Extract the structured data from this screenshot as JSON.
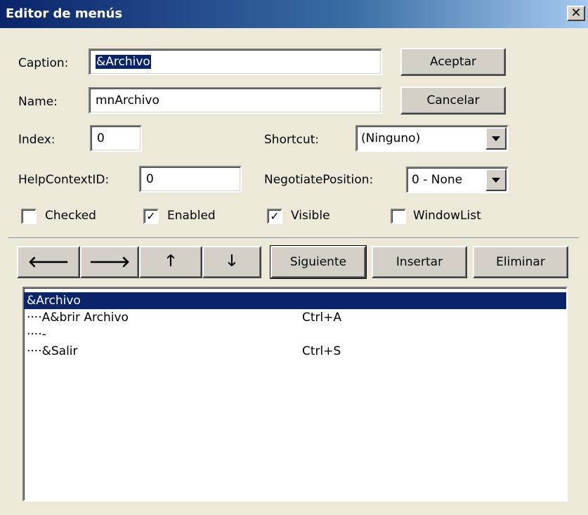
{
  "window": {
    "title": "Editor de menús",
    "close_glyph": "✕"
  },
  "form": {
    "caption_label": "Caption:",
    "caption_value": "&Archivo",
    "name_label": "Name:",
    "name_value": "mnArchivo",
    "index_label": "Index:",
    "index_value": "0",
    "shortcut_label": "Shortcut:",
    "shortcut_value": "(Ninguno)",
    "helpcontextid_label": "HelpContextID:",
    "helpcontextid_value": "0",
    "negotiate_label": "NegotiatePosition:",
    "negotiate_value": "0 - None"
  },
  "buttons": {
    "ok": "Aceptar",
    "cancel": "Cancelar"
  },
  "checkboxes": [
    {
      "label": "Checked",
      "checked": false
    },
    {
      "label": "Enabled",
      "checked": true
    },
    {
      "label": "Visible",
      "checked": true
    },
    {
      "label": "WindowList",
      "checked": false
    }
  ],
  "nav": {
    "left_icon": "left-arrow-icon",
    "right_icon": "right-arrow-icon",
    "up_icon": "up-arrow-icon",
    "down_icon": "down-arrow-icon",
    "left_glyph": "🡐",
    "right_glyph": "🡒",
    "up_glyph": "🡑",
    "down_glyph": "🡓",
    "next": "Siguiente",
    "insert": "Insertar",
    "delete": "Eliminar"
  },
  "menu_list": [
    {
      "text": "&Archivo",
      "shortcut": "",
      "selected": true
    },
    {
      "text": "····A&brir Archivo",
      "shortcut": "Ctrl+A",
      "selected": false
    },
    {
      "text": "····-",
      "shortcut": "",
      "selected": false
    },
    {
      "text": "····&Salir",
      "shortcut": "Ctrl+S",
      "selected": false
    }
  ],
  "colors": {
    "selection": "#0a246a",
    "face": "#d4d0c8",
    "dialog_bg": "#ece9d8"
  }
}
